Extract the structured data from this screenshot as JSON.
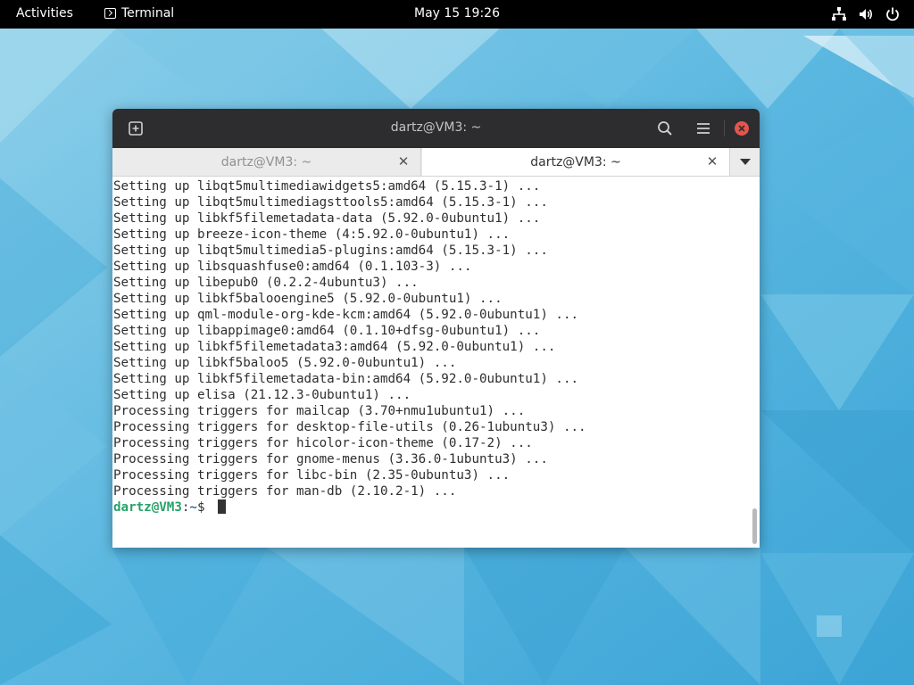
{
  "topbar": {
    "activities": "Activities",
    "app_name": "Terminal",
    "clock": "May 15  19:26",
    "tray_icons": [
      "network-icon",
      "volume-icon",
      "power-icon"
    ]
  },
  "window": {
    "title": "dartz@VM3: ~",
    "tabs": [
      {
        "label": "dartz@VM3: ~",
        "active": false
      },
      {
        "label": "dartz@VM3: ~",
        "active": true
      }
    ],
    "close_button_color": "#e5554d"
  },
  "terminal": {
    "lines": [
      "Setting up libqt5multimediawidgets5:amd64 (5.15.3-1) ...",
      "Setting up libqt5multimediagsttools5:amd64 (5.15.3-1) ...",
      "Setting up libkf5filemetadata-data (5.92.0-0ubuntu1) ...",
      "Setting up breeze-icon-theme (4:5.92.0-0ubuntu1) ...",
      "Setting up libqt5multimedia5-plugins:amd64 (5.15.3-1) ...",
      "Setting up libsquashfuse0:amd64 (0.1.103-3) ...",
      "Setting up libepub0 (0.2.2-4ubuntu3) ...",
      "Setting up libkf5balooengine5 (5.92.0-0ubuntu1) ...",
      "Setting up qml-module-org-kde-kcm:amd64 (5.92.0-0ubuntu1) ...",
      "Setting up libappimage0:amd64 (0.1.10+dfsg-0ubuntu1) ...",
      "Setting up libkf5filemetadata3:amd64 (5.92.0-0ubuntu1) ...",
      "Setting up libkf5baloo5 (5.92.0-0ubuntu1) ...",
      "Setting up libkf5filemetadata-bin:amd64 (5.92.0-0ubuntu1) ...",
      "Setting up elisa (21.12.3-0ubuntu1) ...",
      "Processing triggers for mailcap (3.70+nmu1ubuntu1) ...",
      "Processing triggers for desktop-file-utils (0.26-1ubuntu3) ...",
      "Processing triggers for hicolor-icon-theme (0.17-2) ...",
      "Processing triggers for gnome-menus (3.36.0-1ubuntu3) ...",
      "Processing triggers for libc-bin (2.35-0ubuntu3) ...",
      "Processing triggers for man-db (2.10.2-1) ..."
    ],
    "prompt": {
      "user_host": "dartz@VM3",
      "separator": ":",
      "path": "~",
      "symbol": "$ "
    }
  }
}
